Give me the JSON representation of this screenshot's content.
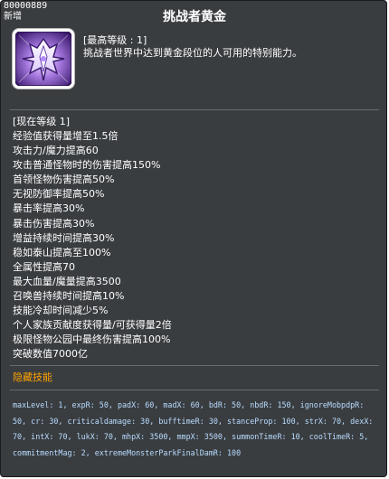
{
  "tooltip": {
    "skill_id": "80000889",
    "tag": "新增",
    "title": "挑战者黄金",
    "icon": "purple-crystal-emblem-icon",
    "max_level": "[最高等级 : 1]",
    "description": "挑战者世界中达到黄金段位的人可用的特别能力。",
    "current_level": "[现在等级 1]",
    "effects": [
      "经验值获得量增至1.5倍",
      "攻击力/魔力提高60",
      "攻击普通怪物时的伤害提高150%",
      "首领怪物伤害提高50%",
      "无视防御率提高50%",
      "暴击率提高30%",
      "暴击伤害提高30%",
      "增益持续时间提高30%",
      "稳如泰山提高至100%",
      "全属性提高70",
      "最大血量/魔量提高3500",
      "召唤兽持续时间提高10%",
      "技能冷却时间减少5%",
      "个人家族贡献度获得量/可获得量2倍",
      "极限怪物公园中最终伤害提高100%",
      "突破数值7000亿"
    ],
    "hidden_label": "隐藏技能",
    "params": "maxLevel: 1, expR: 50, padX: 60, madX: 60, bdR: 50, nbdR: 150, ignoreMobpdpR: 50, cr: 30, criticaldamage: 30, bufftimeR: 30, stanceProp: 100, strX: 70, dexX: 70, intX: 70, lukX: 70, mhpX: 3500, mmpX: 3500, summonTimeR: 10, coolTimeR: 5, commitmentMag: 2, extremeMonsterParkFinalDamR: 100",
    "colors": {
      "background": "#3a3d40",
      "text": "#ffffff",
      "hidden_label": "#ffa200",
      "params": "#b8dcff"
    }
  }
}
